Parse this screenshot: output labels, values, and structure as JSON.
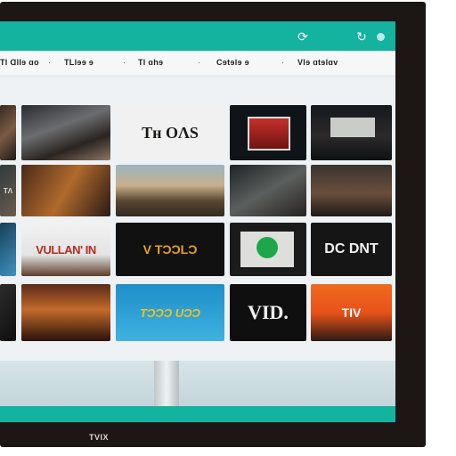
{
  "header": {
    "left_icon": "refresh-circle-icon",
    "right_icon": "share-icon",
    "accent_color": "#14b3a0"
  },
  "nav": {
    "items": [
      "Tl Ɑllɘ ɑo",
      "TLlɘɘ ɘ",
      "Tl ɑhɘ",
      "Cɘtɘlɘ ɘ",
      "Vlɘ ɑtɘlɑv"
    ],
    "separators": [
      "·",
      "·",
      "·",
      "·"
    ]
  },
  "tiles": [
    {
      "label": ""
    },
    {
      "label": ""
    },
    {
      "label": "Tʜ OɅS"
    },
    {
      "label": ""
    },
    {
      "label": ""
    },
    {
      "label": "TɅ"
    },
    {
      "label": ""
    },
    {
      "label": ""
    },
    {
      "label": ""
    },
    {
      "label": ""
    },
    {
      "label": ""
    },
    {
      "label": "VULLAN' IN"
    },
    {
      "label": "V TƆƆLƆ"
    },
    {
      "label": ""
    },
    {
      "label": "DC DNT"
    },
    {
      "label": ""
    },
    {
      "label": ""
    },
    {
      "label": "TƆƆƆ UƆƆ"
    },
    {
      "label": "VID."
    },
    {
      "label": "TIV"
    }
  ],
  "brand": {
    "logo_text": "TVIX"
  }
}
